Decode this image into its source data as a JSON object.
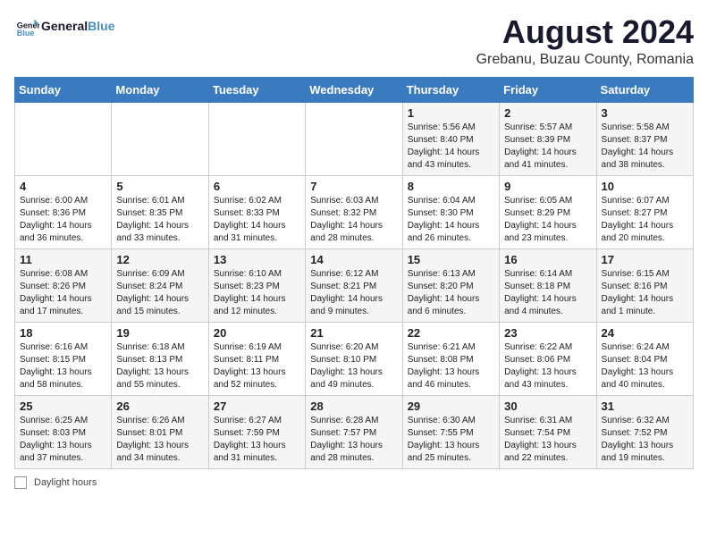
{
  "header": {
    "logo_line1": "General",
    "logo_line2": "Blue",
    "month_year": "August 2024",
    "location": "Grebanu, Buzau County, Romania"
  },
  "days_of_week": [
    "Sunday",
    "Monday",
    "Tuesday",
    "Wednesday",
    "Thursday",
    "Friday",
    "Saturday"
  ],
  "weeks": [
    [
      {
        "day": "",
        "info": ""
      },
      {
        "day": "",
        "info": ""
      },
      {
        "day": "",
        "info": ""
      },
      {
        "day": "",
        "info": ""
      },
      {
        "day": "1",
        "info": "Sunrise: 5:56 AM\nSunset: 8:40 PM\nDaylight: 14 hours\nand 43 minutes."
      },
      {
        "day": "2",
        "info": "Sunrise: 5:57 AM\nSunset: 8:39 PM\nDaylight: 14 hours\nand 41 minutes."
      },
      {
        "day": "3",
        "info": "Sunrise: 5:58 AM\nSunset: 8:37 PM\nDaylight: 14 hours\nand 38 minutes."
      }
    ],
    [
      {
        "day": "4",
        "info": "Sunrise: 6:00 AM\nSunset: 8:36 PM\nDaylight: 14 hours\nand 36 minutes."
      },
      {
        "day": "5",
        "info": "Sunrise: 6:01 AM\nSunset: 8:35 PM\nDaylight: 14 hours\nand 33 minutes."
      },
      {
        "day": "6",
        "info": "Sunrise: 6:02 AM\nSunset: 8:33 PM\nDaylight: 14 hours\nand 31 minutes."
      },
      {
        "day": "7",
        "info": "Sunrise: 6:03 AM\nSunset: 8:32 PM\nDaylight: 14 hours\nand 28 minutes."
      },
      {
        "day": "8",
        "info": "Sunrise: 6:04 AM\nSunset: 8:30 PM\nDaylight: 14 hours\nand 26 minutes."
      },
      {
        "day": "9",
        "info": "Sunrise: 6:05 AM\nSunset: 8:29 PM\nDaylight: 14 hours\nand 23 minutes."
      },
      {
        "day": "10",
        "info": "Sunrise: 6:07 AM\nSunset: 8:27 PM\nDaylight: 14 hours\nand 20 minutes."
      }
    ],
    [
      {
        "day": "11",
        "info": "Sunrise: 6:08 AM\nSunset: 8:26 PM\nDaylight: 14 hours\nand 17 minutes."
      },
      {
        "day": "12",
        "info": "Sunrise: 6:09 AM\nSunset: 8:24 PM\nDaylight: 14 hours\nand 15 minutes."
      },
      {
        "day": "13",
        "info": "Sunrise: 6:10 AM\nSunset: 8:23 PM\nDaylight: 14 hours\nand 12 minutes."
      },
      {
        "day": "14",
        "info": "Sunrise: 6:12 AM\nSunset: 8:21 PM\nDaylight: 14 hours\nand 9 minutes."
      },
      {
        "day": "15",
        "info": "Sunrise: 6:13 AM\nSunset: 8:20 PM\nDaylight: 14 hours\nand 6 minutes."
      },
      {
        "day": "16",
        "info": "Sunrise: 6:14 AM\nSunset: 8:18 PM\nDaylight: 14 hours\nand 4 minutes."
      },
      {
        "day": "17",
        "info": "Sunrise: 6:15 AM\nSunset: 8:16 PM\nDaylight: 14 hours\nand 1 minute."
      }
    ],
    [
      {
        "day": "18",
        "info": "Sunrise: 6:16 AM\nSunset: 8:15 PM\nDaylight: 13 hours\nand 58 minutes."
      },
      {
        "day": "19",
        "info": "Sunrise: 6:18 AM\nSunset: 8:13 PM\nDaylight: 13 hours\nand 55 minutes."
      },
      {
        "day": "20",
        "info": "Sunrise: 6:19 AM\nSunset: 8:11 PM\nDaylight: 13 hours\nand 52 minutes."
      },
      {
        "day": "21",
        "info": "Sunrise: 6:20 AM\nSunset: 8:10 PM\nDaylight: 13 hours\nand 49 minutes."
      },
      {
        "day": "22",
        "info": "Sunrise: 6:21 AM\nSunset: 8:08 PM\nDaylight: 13 hours\nand 46 minutes."
      },
      {
        "day": "23",
        "info": "Sunrise: 6:22 AM\nSunset: 8:06 PM\nDaylight: 13 hours\nand 43 minutes."
      },
      {
        "day": "24",
        "info": "Sunrise: 6:24 AM\nSunset: 8:04 PM\nDaylight: 13 hours\nand 40 minutes."
      }
    ],
    [
      {
        "day": "25",
        "info": "Sunrise: 6:25 AM\nSunset: 8:03 PM\nDaylight: 13 hours\nand 37 minutes."
      },
      {
        "day": "26",
        "info": "Sunrise: 6:26 AM\nSunset: 8:01 PM\nDaylight: 13 hours\nand 34 minutes."
      },
      {
        "day": "27",
        "info": "Sunrise: 6:27 AM\nSunset: 7:59 PM\nDaylight: 13 hours\nand 31 minutes."
      },
      {
        "day": "28",
        "info": "Sunrise: 6:28 AM\nSunset: 7:57 PM\nDaylight: 13 hours\nand 28 minutes."
      },
      {
        "day": "29",
        "info": "Sunrise: 6:30 AM\nSunset: 7:55 PM\nDaylight: 13 hours\nand 25 minutes."
      },
      {
        "day": "30",
        "info": "Sunrise: 6:31 AM\nSunset: 7:54 PM\nDaylight: 13 hours\nand 22 minutes."
      },
      {
        "day": "31",
        "info": "Sunrise: 6:32 AM\nSunset: 7:52 PM\nDaylight: 13 hours\nand 19 minutes."
      }
    ]
  ],
  "footer": {
    "daylight_label": "Daylight hours"
  }
}
